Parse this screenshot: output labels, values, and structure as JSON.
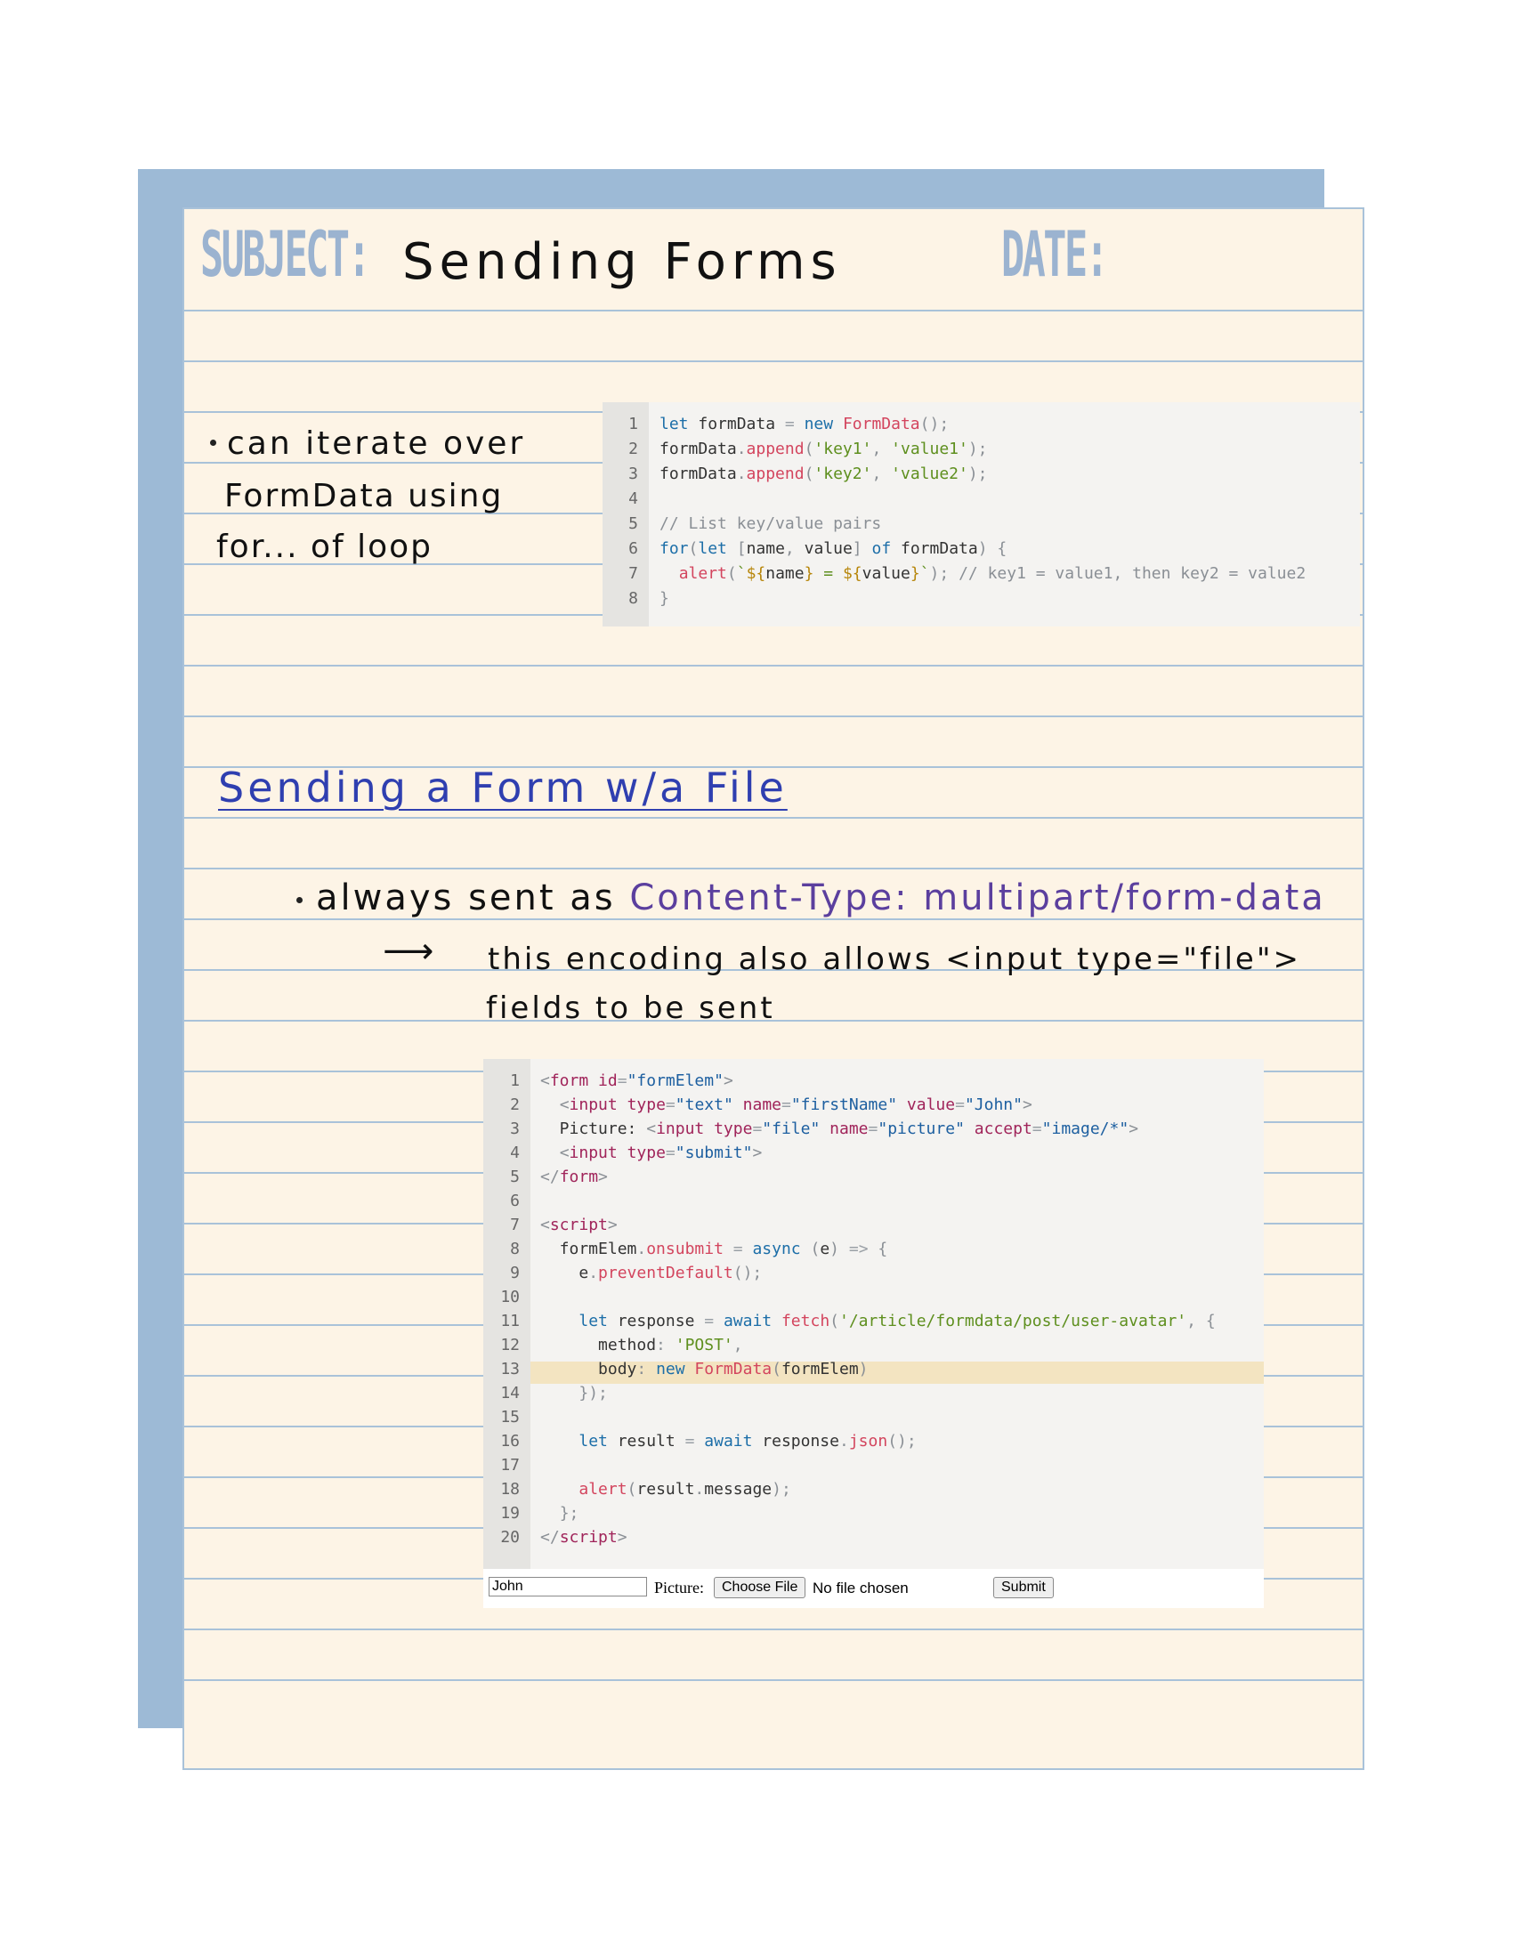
{
  "header": {
    "subject_label": "SUBJECT:",
    "subject_value": "Sending Forms",
    "date_label": "DATE:"
  },
  "note1": {
    "lines": [
      "can iterate over",
      "FormData using",
      "for... of loop"
    ]
  },
  "code1": {
    "line_numbers": [
      "1",
      "2",
      "3",
      "4",
      "5",
      "6",
      "7",
      "8"
    ]
  },
  "section2": {
    "heading": "Sending a Form w/a File",
    "bullet_prefix": "always sent as ",
    "bullet_highlight": "Content-Type: multipart/form-data",
    "arrow": "⟶",
    "sub_line1": "this encoding also allows <input type=\"file\">",
    "sub_line2": "fields to be sent"
  },
  "code2": {
    "line_numbers": [
      "1",
      "2",
      "3",
      "4",
      "5",
      "6",
      "7",
      "8",
      "9",
      "10",
      "11",
      "12",
      "13",
      "14",
      "15",
      "16",
      "17",
      "18",
      "19",
      "20"
    ],
    "highlighted_line": 13
  },
  "demo_form": {
    "text_value": "John",
    "picture_label": "Picture:",
    "choose_file_label": "Choose File",
    "no_file_text": "No file chosen",
    "submit_label": "Submit"
  },
  "colors": {
    "paper": "#fdf4e6",
    "back_card": "#9dbad6",
    "rule_line": "#a9c2d9",
    "header_label": "#9bb3d0",
    "heading_ink": "#2f3fb0",
    "purple_ink": "#5b3f9e",
    "code_bg": "#f4f3f1",
    "highlight_line": "#f3e4c1"
  }
}
